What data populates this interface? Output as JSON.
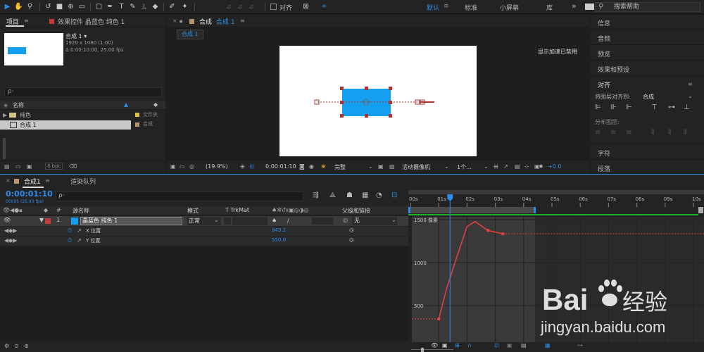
{
  "toolbar": {
    "align_label": "对齐",
    "workspaces": [
      "默认",
      "标准",
      "小屏幕",
      "库"
    ],
    "more": "»",
    "search_placeholder": "搜索帮助"
  },
  "project": {
    "tab_label": "项目",
    "effects_tab_label": "效果控件 晶蓝色 纯色 1",
    "comp_name": "合成 1",
    "comp_size": "1920 x 1080 (1.00)",
    "comp_duration": "Δ 0:00:10:00, 25.00 fps",
    "name_header": "名称",
    "items": [
      {
        "name": "纯色",
        "type": "文件夹"
      },
      {
        "name": "合成 1",
        "type": "合成"
      }
    ],
    "bpc": "8 bpc"
  },
  "viewer": {
    "tab_label": "合成",
    "tab_comp": "合成 1",
    "subtab": "合成 1",
    "accel_notice": "显示加速已禁用",
    "zoom": "(19.9%)",
    "timecode": "0:00:01:10",
    "quality": "完整",
    "camera": "活动摄像机",
    "views": "1个...",
    "exposure": "+0.0"
  },
  "right_panel": {
    "items": [
      "信息",
      "音频",
      "预览",
      "效果和预设"
    ],
    "align_title": "对齐",
    "align_to_label": "将图层对齐到:",
    "align_to_value": "合成",
    "distribute_label": "分布图层:",
    "bottom_items": [
      "字符",
      "段落"
    ]
  },
  "timeline": {
    "tab_label": "合成1",
    "render_queue_tab": "渲染队列",
    "timecode": "0:00:01:10",
    "frame_info": "00035 (25.00 fps)",
    "search_placeholder": "ρ·",
    "columns": {
      "source_name": "源名称",
      "mode": "模式",
      "trkmat": "T TrkMat",
      "parent": "父级和链接"
    },
    "layer": {
      "number": "1",
      "name": "晶蓝色 纯色 1",
      "mode": "正常",
      "parent": "无"
    },
    "props": [
      {
        "name": "X 位置",
        "value": "843.2"
      },
      {
        "name": "Y 位置",
        "value": "550.0"
      }
    ],
    "ruler": [
      "00s",
      "01s",
      "02s",
      "03s",
      "04s",
      "05s",
      "06s",
      "07s",
      "08s",
      "09s",
      "10s"
    ],
    "graph_labels": [
      "1500 像素",
      "1000",
      "500"
    ],
    "graph_curve": [
      {
        "t": 0,
        "v": 344
      },
      {
        "t": 0.28,
        "v": 700
      },
      {
        "t": 0.66,
        "v": 1085
      },
      {
        "t": 1.0,
        "v": 1420
      },
      {
        "t": 1.28,
        "v": 1478
      },
      {
        "t": 1.74,
        "v": 1375
      },
      {
        "t": 2.27,
        "v": 1335
      },
      {
        "t": 10,
        "v": 1335
      }
    ]
  },
  "colors": {
    "accent": "#2d8ceb",
    "solid": "#14a0f0",
    "curve": "#e84040",
    "work_area": "#1fae2a",
    "layer_label": "#c23a3a"
  },
  "watermark": {
    "logo_text": "Bai 经验",
    "url": "jingyan.baidu.com"
  }
}
